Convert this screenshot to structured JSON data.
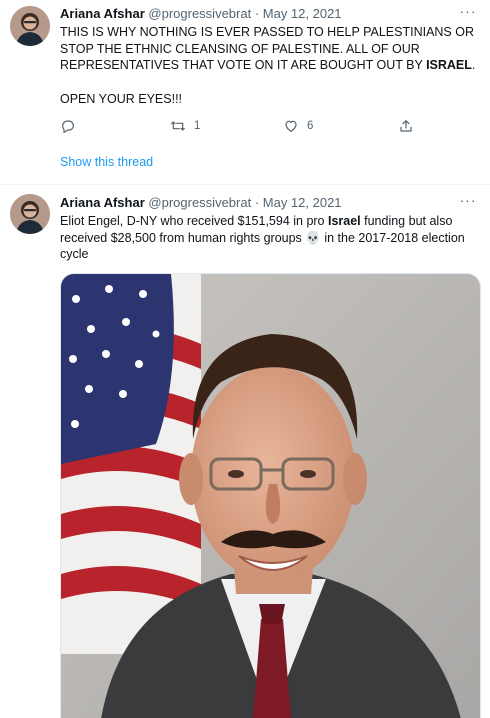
{
  "tweets": [
    {
      "author_name": "Ariana Afshar",
      "handle": "@progressivebrat",
      "separator": " · ",
      "date": "May 12, 2021",
      "text_parts": [
        {
          "t": "THIS IS WHY NOTHING IS EVER PASSED TO HELP PALESTINIANS OR STOP THE ETHNIC CLEANSING OF PALESTINE. ALL OF OUR REPRESENTATIVES THAT VOTE ON IT ARE BOUGHT OUT BY "
        },
        {
          "t": "ISRAEL",
          "bold": true
        },
        {
          "t": "."
        }
      ],
      "text_line2": "OPEN YOUR EYES!!!",
      "reply_count": "",
      "retweet_count": "1",
      "like_count": "6",
      "show_thread_label": "Show this thread",
      "more_label": "···"
    },
    {
      "author_name": "Ariana Afshar",
      "handle": "@progressivebrat",
      "separator": " · ",
      "date": "May 12, 2021",
      "text_before": "Eliot Engel, D-NY who received $151,594 in pro ",
      "text_bold": "Israel",
      "text_after": " funding but also received $28,500 from human rights groups",
      "emoji": "💀",
      "text_end": " in the 2017-2018 election cycle",
      "more_label": "···"
    }
  ],
  "colors": {
    "link_blue": "#1d9bf0",
    "muted": "#536471",
    "text": "#0f1419",
    "divider": "#eff3f4"
  },
  "icons": {
    "reply": "reply-icon",
    "retweet": "retweet-icon",
    "like": "heart-icon",
    "share": "share-icon",
    "more": "more-icon"
  }
}
